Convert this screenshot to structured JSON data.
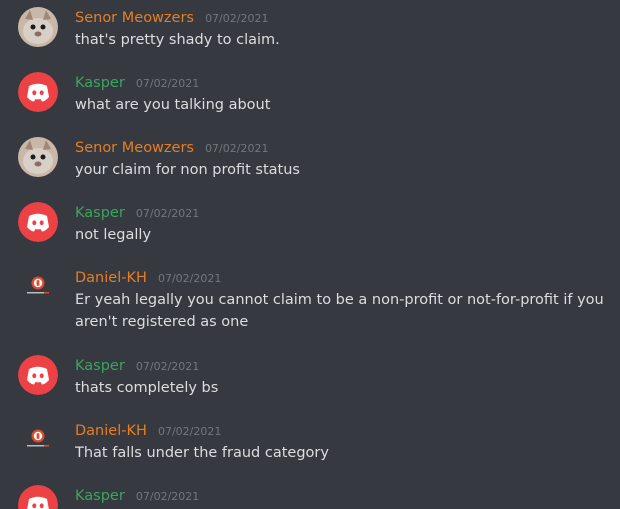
{
  "colors": {
    "background": "#36393f",
    "senor": "#e67e22",
    "kasper": "#3ba55c",
    "daniel": "#e67e22",
    "discord_red": "#ed4245",
    "timestamp": "#72767d",
    "text": "#dcddde"
  },
  "avatars": {
    "senor": "cat-photo-avatar",
    "kasper": "discord-logo-icon",
    "daniel": "kh-logo-avatar"
  },
  "messages": [
    {
      "author": "Senor Meowzers",
      "timestamp": "07/02/2021",
      "text": "that's pretty shady to claim."
    },
    {
      "author": "Kasper",
      "timestamp": "07/02/2021",
      "text": "what are you talking about"
    },
    {
      "author": "Senor Meowzers",
      "timestamp": "07/02/2021",
      "text": "your claim for non profit status"
    },
    {
      "author": "Kasper",
      "timestamp": "07/02/2021",
      "text": "not legally"
    },
    {
      "author": "Daniel-KH",
      "timestamp": "07/02/2021",
      "text": "Er yeah legally you cannot claim to be a non-profit or not-for-profit if you aren't registered as one"
    },
    {
      "author": "Kasper",
      "timestamp": "07/02/2021",
      "text": "thats completely bs"
    },
    {
      "author": "Daniel-KH",
      "timestamp": "07/02/2021",
      "text": "That falls under the fraud category"
    },
    {
      "author": "Kasper",
      "timestamp": "07/02/2021",
      "text": ""
    }
  ]
}
